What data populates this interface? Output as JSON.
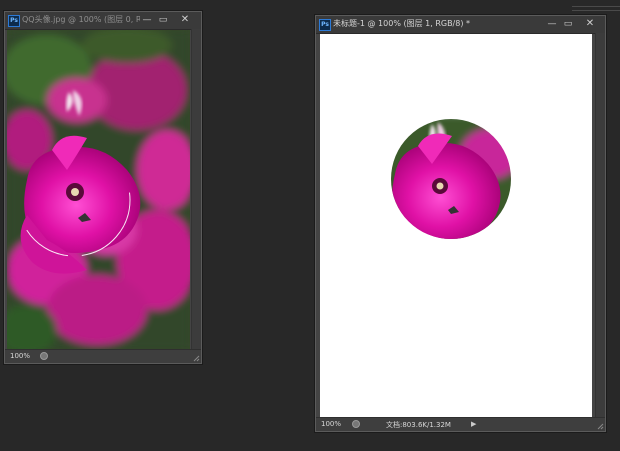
{
  "windows": [
    {
      "title": "QQ头像.jpg @ 100% (图层 0, R...",
      "zoom": "100%",
      "buttons": [
        "—",
        "▭",
        "✕"
      ]
    },
    {
      "title": "未标题-1 @ 100% (图层 1, RGB/8) *",
      "zoom": "100%",
      "doc_info": "文档:803.6K/1.32M",
      "buttons": [
        "—",
        "▭",
        "✕"
      ]
    }
  ],
  "app_icon_label": "Ps",
  "status_arrow": "▶",
  "colors": {
    "flower": "#e011a6",
    "background": "#282828",
    "canvas": "#ffffff"
  }
}
